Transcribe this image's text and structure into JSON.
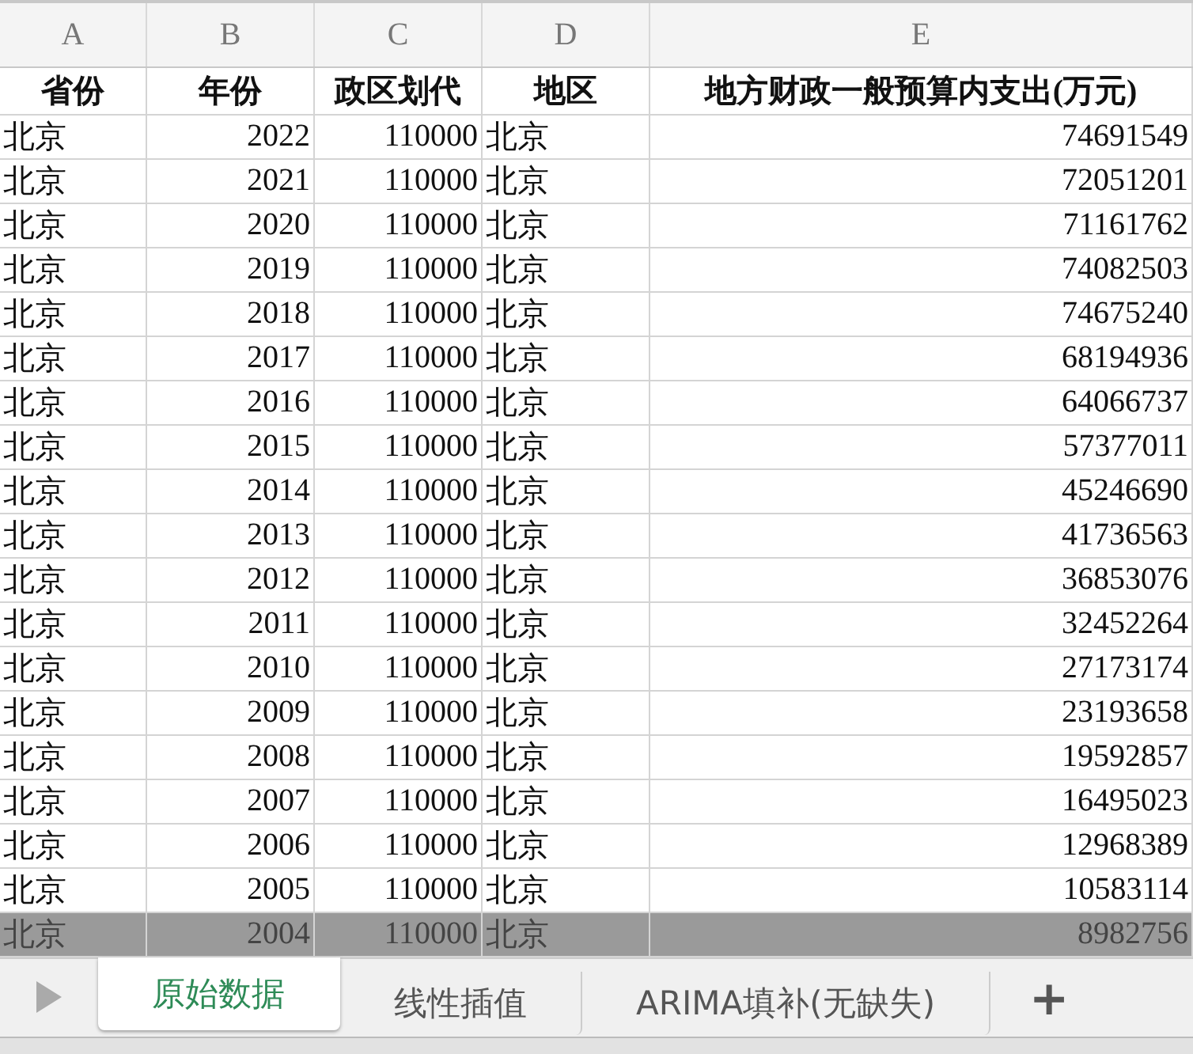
{
  "column_letters": [
    "A",
    "B",
    "C",
    "D",
    "E"
  ],
  "header": [
    "省份",
    "年份",
    "政区划代",
    "地区",
    "地方财政一般预算内支出(万元)"
  ],
  "rows": [
    {
      "cells": [
        "北京",
        "2022",
        "110000",
        "北京",
        "74691549"
      ],
      "highlighted": false
    },
    {
      "cells": [
        "北京",
        "2021",
        "110000",
        "北京",
        "72051201"
      ],
      "highlighted": false
    },
    {
      "cells": [
        "北京",
        "2020",
        "110000",
        "北京",
        "71161762"
      ],
      "highlighted": false
    },
    {
      "cells": [
        "北京",
        "2019",
        "110000",
        "北京",
        "74082503"
      ],
      "highlighted": false
    },
    {
      "cells": [
        "北京",
        "2018",
        "110000",
        "北京",
        "74675240"
      ],
      "highlighted": false
    },
    {
      "cells": [
        "北京",
        "2017",
        "110000",
        "北京",
        "68194936"
      ],
      "highlighted": false
    },
    {
      "cells": [
        "北京",
        "2016",
        "110000",
        "北京",
        "64066737"
      ],
      "highlighted": false
    },
    {
      "cells": [
        "北京",
        "2015",
        "110000",
        "北京",
        "57377011"
      ],
      "highlighted": false
    },
    {
      "cells": [
        "北京",
        "2014",
        "110000",
        "北京",
        "45246690"
      ],
      "highlighted": false
    },
    {
      "cells": [
        "北京",
        "2013",
        "110000",
        "北京",
        "41736563"
      ],
      "highlighted": false
    },
    {
      "cells": [
        "北京",
        "2012",
        "110000",
        "北京",
        "36853076"
      ],
      "highlighted": false
    },
    {
      "cells": [
        "北京",
        "2011",
        "110000",
        "北京",
        "32452264"
      ],
      "highlighted": false
    },
    {
      "cells": [
        "北京",
        "2010",
        "110000",
        "北京",
        "27173174"
      ],
      "highlighted": false
    },
    {
      "cells": [
        "北京",
        "2009",
        "110000",
        "北京",
        "23193658"
      ],
      "highlighted": false
    },
    {
      "cells": [
        "北京",
        "2008",
        "110000",
        "北京",
        "19592857"
      ],
      "highlighted": false
    },
    {
      "cells": [
        "北京",
        "2007",
        "110000",
        "北京",
        "16495023"
      ],
      "highlighted": false
    },
    {
      "cells": [
        "北京",
        "2006",
        "110000",
        "北京",
        "12968389"
      ],
      "highlighted": false
    },
    {
      "cells": [
        "北京",
        "2005",
        "110000",
        "北京",
        "10583114"
      ],
      "highlighted": false
    },
    {
      "cells": [
        "北京",
        "2004",
        "110000",
        "北京",
        "8982756"
      ],
      "highlighted": true
    }
  ],
  "sheet_tabs": [
    {
      "label": "原始数据",
      "selected": true
    },
    {
      "label": "线性插值",
      "selected": false
    },
    {
      "label": "ARIMA填补(无缺失)",
      "selected": false
    }
  ],
  "add_sheet": "+"
}
